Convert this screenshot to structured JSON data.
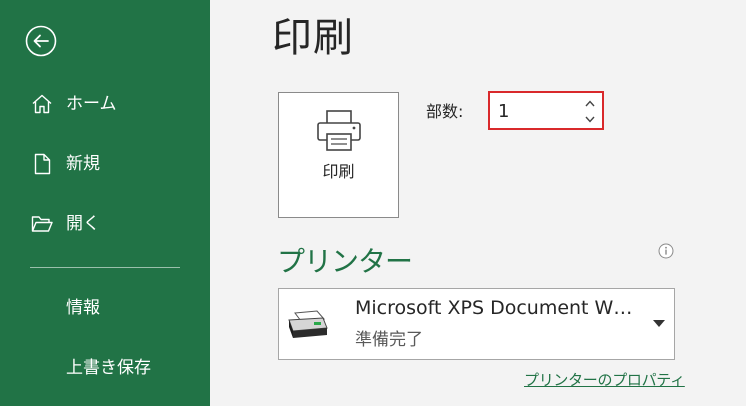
{
  "sidebar": {
    "items": [
      {
        "label": "ホーム"
      },
      {
        "label": "新規"
      },
      {
        "label": "開く"
      },
      {
        "label": "情報"
      },
      {
        "label": "上書き保存"
      }
    ],
    "bg_color": "#217346"
  },
  "main": {
    "title": "印刷",
    "print_button": {
      "label": "印刷",
      "icon": "printer-icon"
    },
    "copies": {
      "label": "部数:",
      "value": "1"
    },
    "printer_section": {
      "title": "プリンター",
      "selected_printer": {
        "name": "Microsoft XPS Document W…",
        "status": "準備完了",
        "icon": "xps-printer-icon"
      },
      "properties_link": "プリンターのプロパティ"
    }
  },
  "colors": {
    "accent": "#217346",
    "highlight_border": "#d9292b"
  }
}
